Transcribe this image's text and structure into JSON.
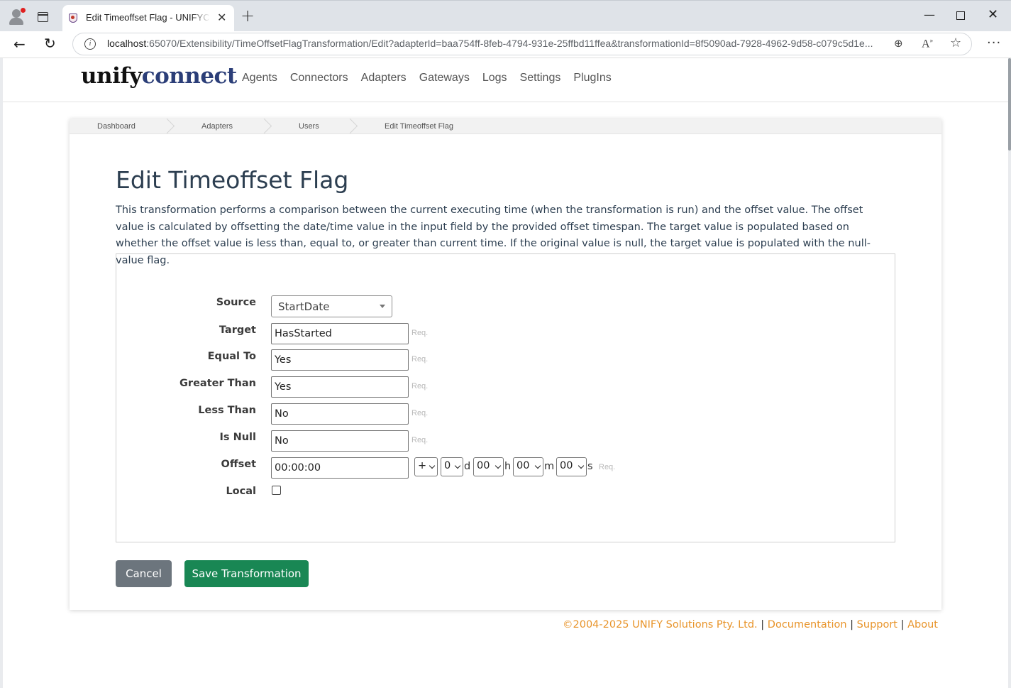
{
  "browser": {
    "tab_title": "Edit Timeoffset Flag - UNIFYConnect",
    "tab_close": "✕",
    "new_tab": "+",
    "url_host": "localhost",
    "url_rest": ":65070/Extensibility/TimeOffsetFlagTransformation/Edit?adapterId=baa754ff-8feb-4794-931e-25ffbd11ffea&transformationId=8f5090ad-7928-4962-9d58-c079c5d1e...",
    "icons": [
      "profile-icon",
      "tab-actions-icon",
      "back-icon",
      "reload-icon",
      "info-icon",
      "zoom-icon",
      "read-aloud-icon",
      "favorite-star-icon",
      "more-icon"
    ]
  },
  "header": {
    "logo_part1": "unify",
    "logo_part2": "connect",
    "nav": [
      "Agents",
      "Connectors",
      "Adapters",
      "Gateways",
      "Logs",
      "Settings",
      "PlugIns"
    ]
  },
  "breadcrumb": [
    "Dashboard",
    "Adapters",
    "Users",
    "Edit Timeoffset Flag"
  ],
  "page": {
    "title": "Edit Timeoffset Flag",
    "description": "This transformation performs a comparison between the current executing time (when the transformation is run) and the offset value. The offset value is calculated by offsetting the date/time value in the input field by the provided offset timespan. The target value is populated based on whether the offset value is less than, equal to, or greater than current time. If the original value is null, the target value is populated with the null-value flag."
  },
  "form": {
    "source": {
      "label": "Source",
      "value": "StartDate"
    },
    "target": {
      "label": "Target",
      "value": "HasStarted",
      "req": "Req."
    },
    "equal_to": {
      "label": "Equal To",
      "value": "Yes",
      "req": "Req."
    },
    "greater_than": {
      "label": "Greater Than",
      "value": "Yes",
      "req": "Req."
    },
    "less_than": {
      "label": "Less Than",
      "value": "No",
      "req": "Req."
    },
    "is_null": {
      "label": "Is Null",
      "value": "No",
      "req": "Req."
    },
    "offset": {
      "label": "Offset",
      "value": "00:00:00",
      "req": "Req.",
      "sign": "+",
      "days": "0",
      "hours": "00",
      "minutes": "00",
      "seconds": "00",
      "unit_d": "d",
      "unit_h": "h",
      "unit_m": "m",
      "unit_s": "s"
    },
    "local": {
      "label": "Local",
      "checked": false
    }
  },
  "buttons": {
    "cancel": "Cancel",
    "save": "Save Transformation"
  },
  "footer": {
    "copyright": "©2004-2025 UNIFY Solutions Pty. Ltd.",
    "sep": "|",
    "documentation": "Documentation",
    "support": "Support",
    "about": "About"
  },
  "colors": {
    "accent_green": "#198754",
    "cancel_gray": "#6c757d",
    "footer_link": "#e8942a",
    "logo_blue": "#2b3e78"
  }
}
